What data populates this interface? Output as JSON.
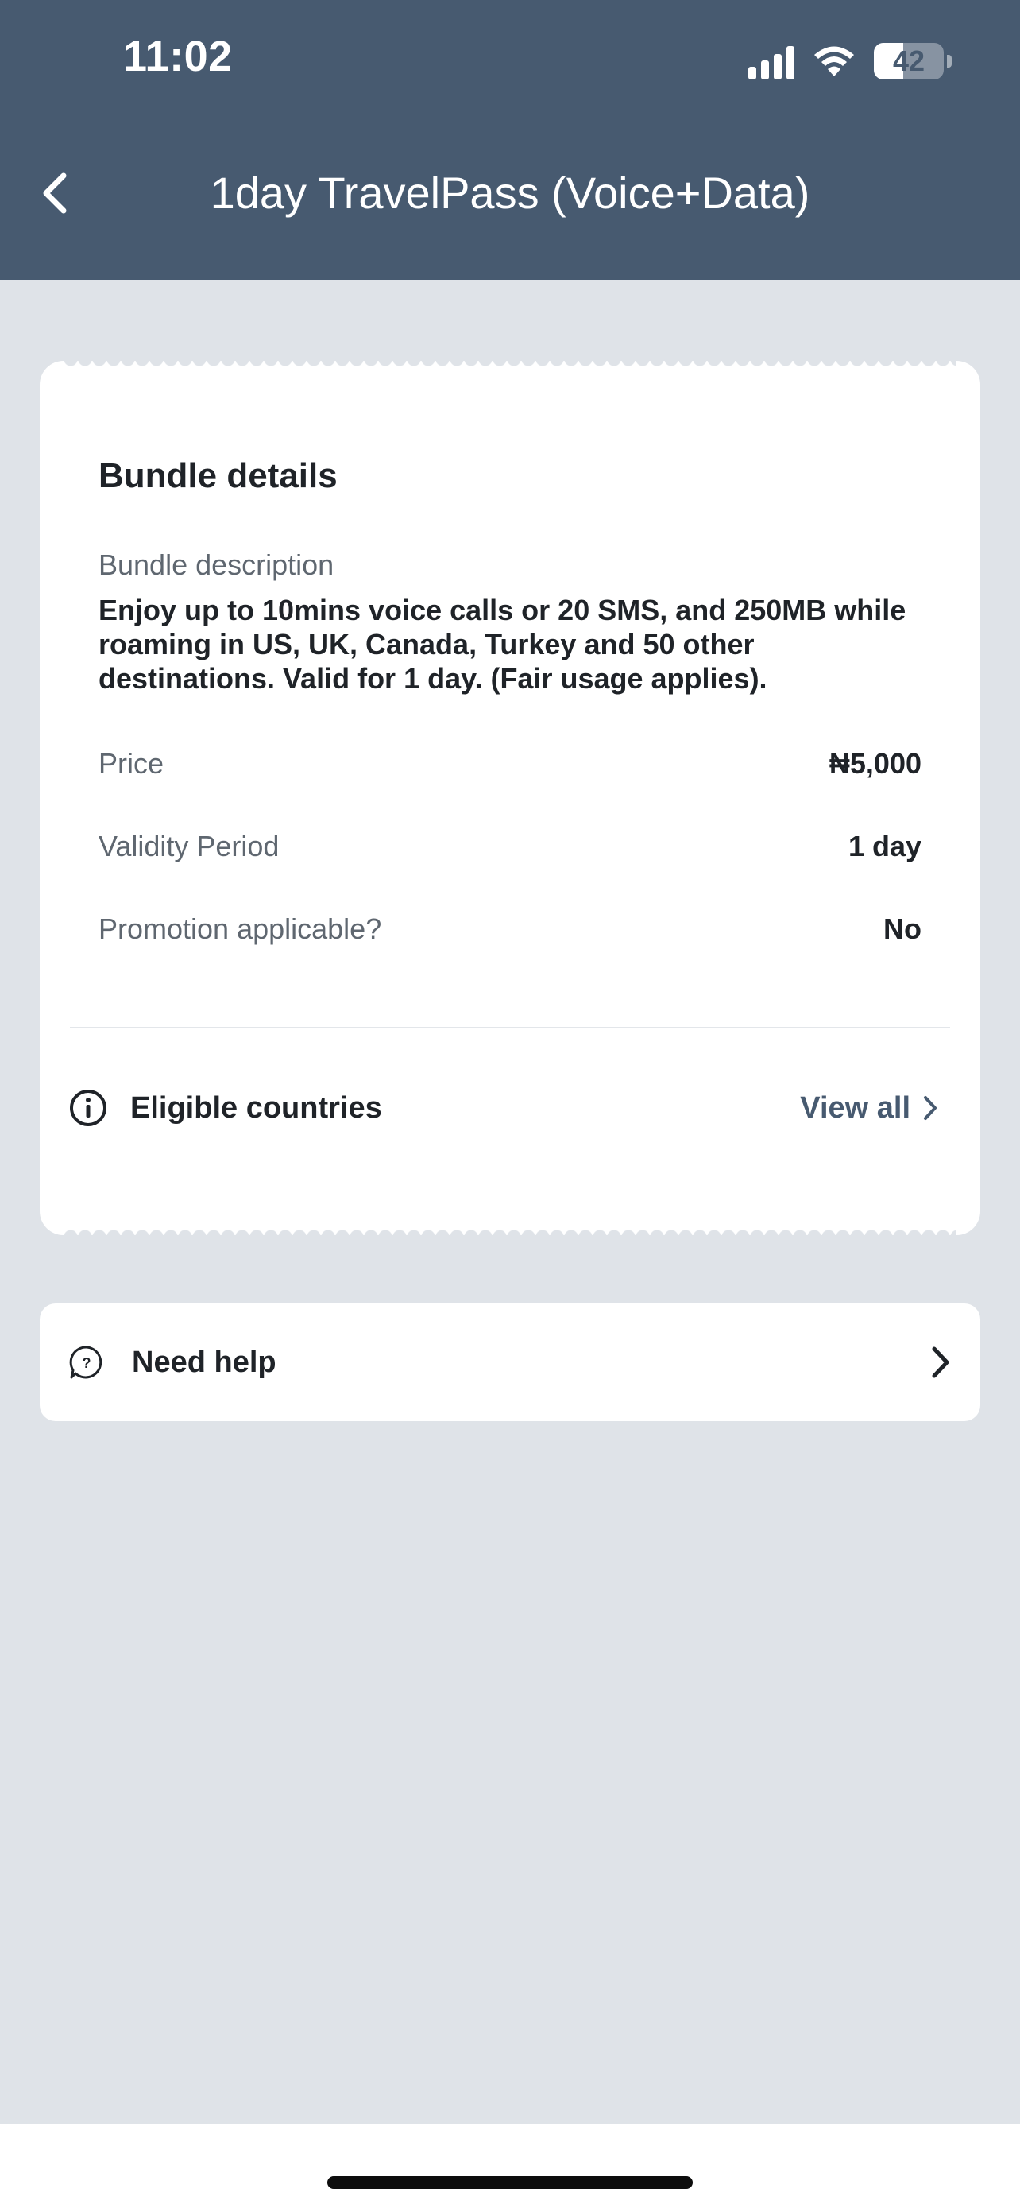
{
  "status_bar": {
    "time": "11:02",
    "battery_level": "42",
    "icons": [
      "signal-icon",
      "wifi-icon",
      "battery-icon"
    ]
  },
  "header": {
    "title": "1day TravelPass (Voice+Data)",
    "back_icon": "chevron-left-icon",
    "background_color": "#475a70"
  },
  "bundle": {
    "section_title": "Bundle details",
    "description_label": "Bundle description",
    "description": "Enjoy up to 10mins voice calls or 20 SMS, and 250MB while roaming in US, UK, Canada, Turkey and 50 other destinations. Valid for 1 day. (Fair usage applies).",
    "rows": [
      {
        "label": "Price",
        "value": "₦5,000"
      },
      {
        "label": "Validity Period",
        "value": "1 day"
      },
      {
        "label": "Promotion applicable?",
        "value": "No"
      }
    ],
    "eligible": {
      "label": "Eligible countries",
      "link_label": "View all",
      "icon": "info-icon"
    }
  },
  "help": {
    "label": "Need help",
    "icon": "help-chat-icon"
  },
  "colors": {
    "background": "#dfe3e8",
    "card": "#ffffff",
    "accent": "#475a70"
  }
}
